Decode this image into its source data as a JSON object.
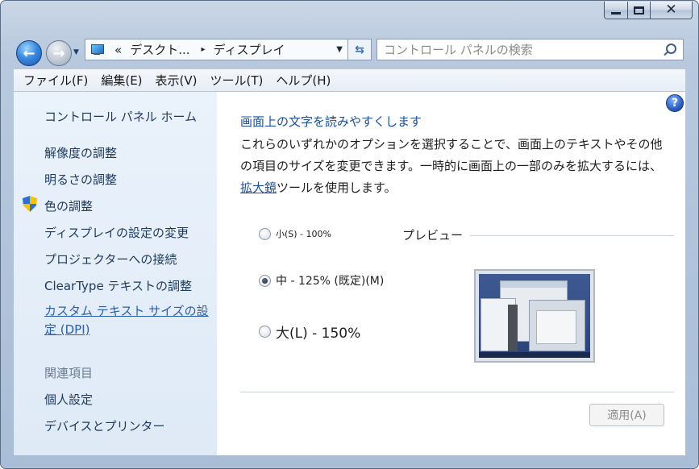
{
  "nav": {
    "address": {
      "prefix": "«",
      "segment1": "デスクト...",
      "separator": "▸",
      "segment2": "ディスプレイ"
    },
    "search_placeholder": "コントロール パネルの検索"
  },
  "menu": [
    "ファイル(F)",
    "編集(E)",
    "表示(V)",
    "ツール(T)",
    "ヘルプ(H)"
  ],
  "sidebar": {
    "home": "コントロール パネル ホーム",
    "items": [
      "解像度の調整",
      "明るさの調整",
      "色の調整",
      "ディスプレイの設定の変更",
      "プロジェクターへの接続",
      "ClearType テキストの調整",
      "カスタム テキスト サイズの設定 (DPI)"
    ],
    "related_heading": "関連項目",
    "related": [
      "個人設定",
      "デバイスとプリンター"
    ]
  },
  "main": {
    "title": "画面上の文字を読みやすくします",
    "description_before": "これらのいずれかのオプションを選択することで、画面上のテキストやその他の項目のサイズを変更できます。一時的に画面上の一部のみを拡大するには、",
    "description_link": "拡大鏡",
    "description_after": "ツールを使用します。",
    "options": [
      {
        "label": "小(S) - 100%",
        "checked": false
      },
      {
        "label": "中 - 125% (既定)(M)",
        "checked": true
      },
      {
        "label": "大(L) - 150%",
        "checked": false
      }
    ],
    "preview_label": "プレビュー",
    "apply_label": "適用(A)"
  },
  "icons": {
    "back": "back-arrow-icon",
    "forward": "forward-arrow-icon",
    "refresh": "refresh-icon",
    "search": "search-icon",
    "help": "help-icon",
    "shield": "uac-shield-icon"
  },
  "colors": {
    "link": "#1a4fa0",
    "sidebar_link": "#1e395b",
    "sidebar_bg": "#e4eef9"
  }
}
